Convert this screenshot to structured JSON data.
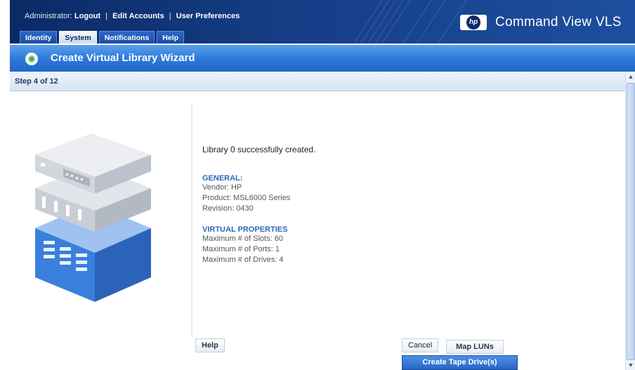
{
  "header": {
    "admin_label": "Administrator:",
    "links": [
      "Logout",
      "Edit Accounts",
      "User Preferences"
    ],
    "separator": "|",
    "tabs": [
      {
        "label": "Identity",
        "active": false
      },
      {
        "label": "System",
        "active": true
      },
      {
        "label": "Notifications",
        "active": false
      },
      {
        "label": "Help",
        "active": false
      }
    ],
    "logo_text": "hp",
    "product_name": "Command View VLS"
  },
  "wizard": {
    "title": "Create Virtual Library Wizard",
    "step": "Step 4 of 12"
  },
  "content": {
    "success_message": "Library 0 successfully created.",
    "general_heading": "GENERAL:",
    "vendor": "Vendor: HP",
    "product": "Product: MSL6000 Series",
    "revision": "Revision: 0430",
    "virtual_heading": "VIRTUAL PROPERTIES",
    "max_slots": "Maximum # of Slots: 60",
    "max_ports": "Maximum # of Ports: 1",
    "max_drives": "Maximum # of Drives: 4"
  },
  "buttons": {
    "help": "Help",
    "cancel": "Cancel",
    "map_luns": "Map LUNs",
    "create_tape_drives": "Create Tape Drive(s)"
  },
  "scrollbar": {
    "up_glyph": "▲",
    "down_glyph": "▼"
  },
  "colors": {
    "header_dark": "#0a2a66",
    "wizard_blue": "#2c78d8",
    "section_heading": "#2f67b8",
    "primary_button": "#2766c4"
  }
}
